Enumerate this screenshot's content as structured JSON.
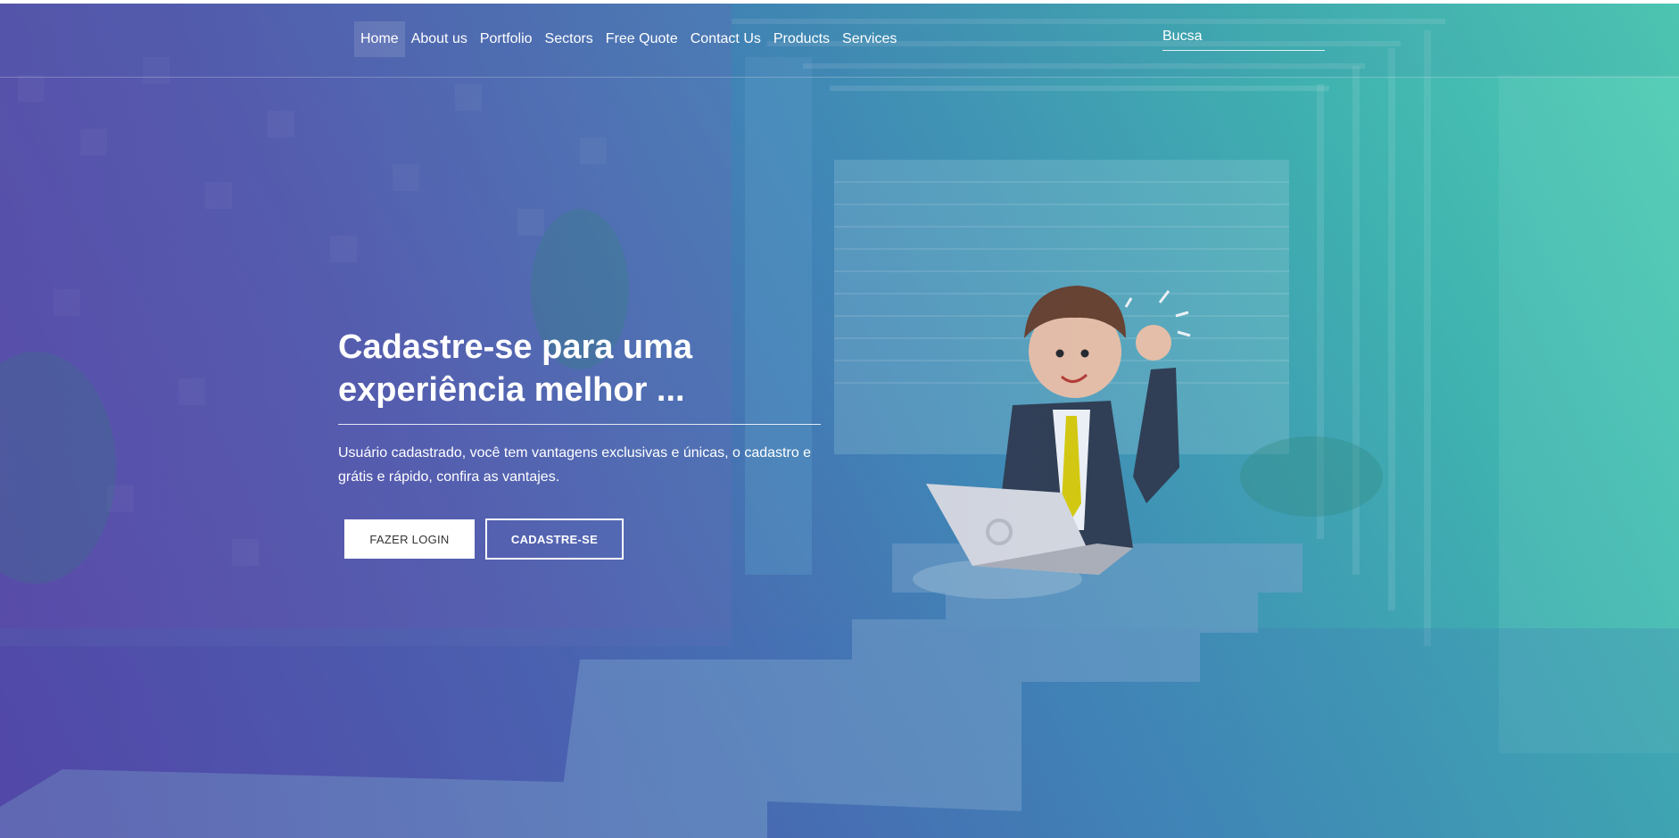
{
  "nav": {
    "items": [
      {
        "label": "Home",
        "active": true
      },
      {
        "label": "About us"
      },
      {
        "label": "Portfolio"
      },
      {
        "label": "Sectors"
      },
      {
        "label": "Free Quote"
      },
      {
        "label": "Contact Us"
      },
      {
        "label": "Products"
      },
      {
        "label": "Services"
      }
    ]
  },
  "search": {
    "placeholder": "Bucsa"
  },
  "hero": {
    "headline_line1": "Cadastre-se para uma",
    "headline_line2": "experiência melhor ...",
    "description": "Usuário cadastrado, você tem vantagens exclusivas e únicas, o cadastro e grátis e rápido, confira as vantajes.",
    "login_label": "FAZER LOGIN",
    "signup_label": "CADASTRE-SE"
  },
  "colors": {
    "gradient_start": "#5a3fa8",
    "gradient_end": "#4fd0b4",
    "tie": "#e3d400",
    "suit": "#2e3a4c"
  },
  "icons": {
    "illustration": "businessman-with-laptop-illustration"
  }
}
